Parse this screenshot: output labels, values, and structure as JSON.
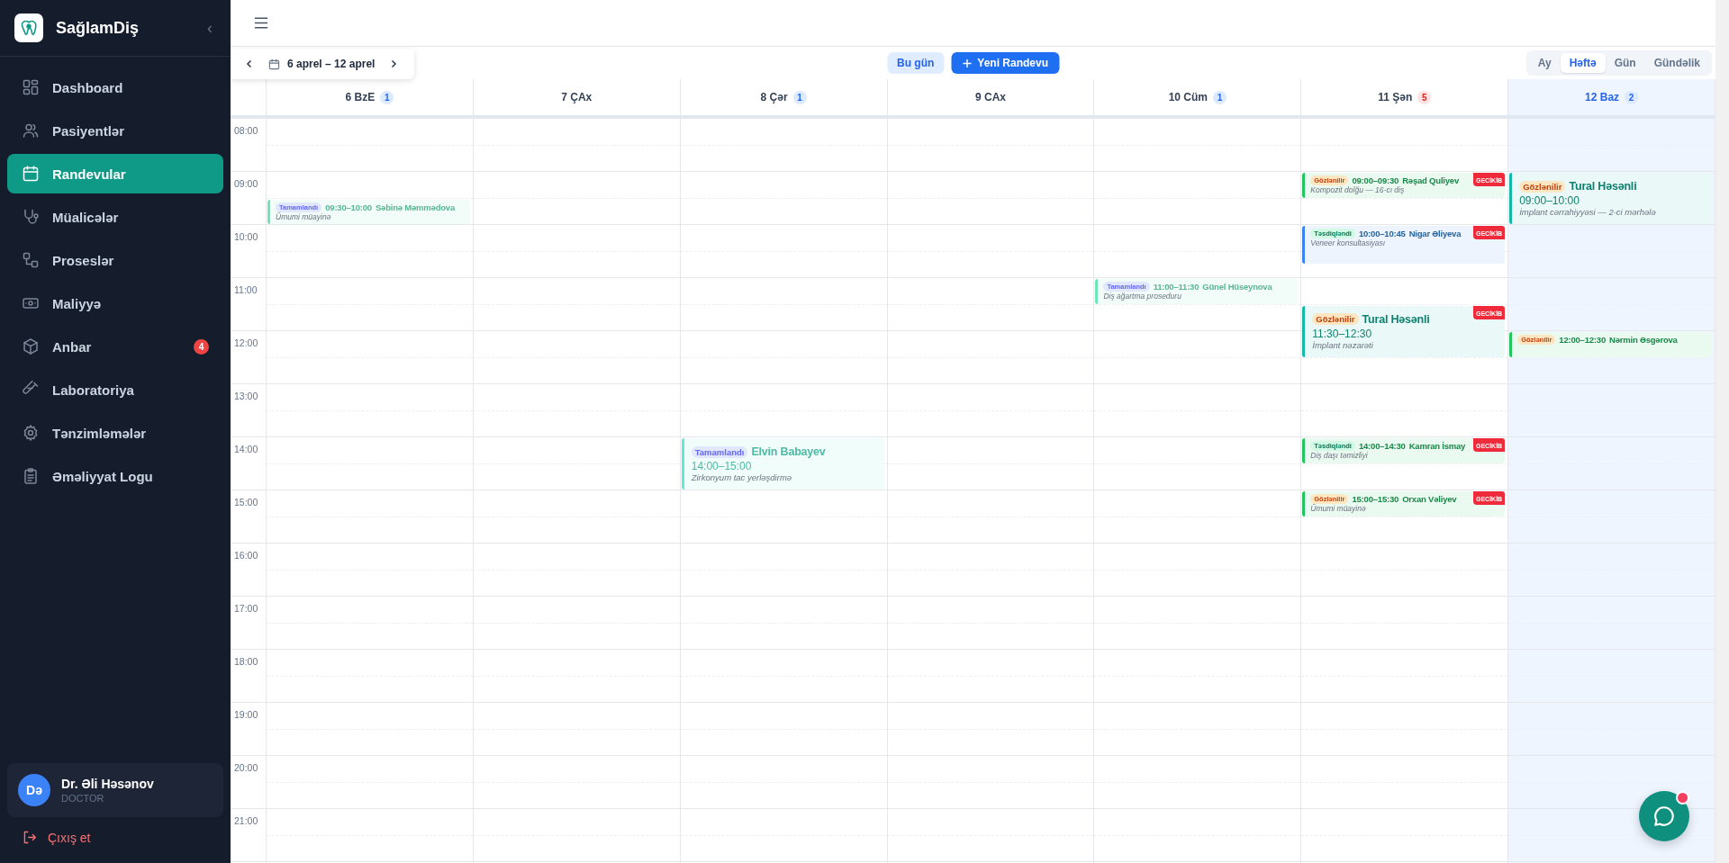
{
  "sidebar": {
    "brand": "SağlamDiş",
    "collapse": "‹",
    "items": [
      {
        "label": "Dashboard",
        "selected": false
      },
      {
        "label": "Pasiyentlər",
        "selected": false
      },
      {
        "label": "Randevular",
        "selected": true
      },
      {
        "label": "Müalicələr",
        "selected": false
      },
      {
        "label": "Proseslər",
        "selected": false
      },
      {
        "label": "Maliyyə",
        "selected": false
      },
      {
        "label": "Anbar",
        "selected": false,
        "badge": "4"
      },
      {
        "label": "Laboratoriya",
        "selected": false
      },
      {
        "label": "Tənzimləmələr",
        "selected": false
      },
      {
        "label": "Əməliyyat Logu",
        "selected": false
      }
    ],
    "user": {
      "initials": "Də",
      "name": "Dr. Əli Həsənov",
      "role": "DOCTOR"
    },
    "logout": "Çıxış et"
  },
  "toolbar": {
    "range": "6 aprel – 12 aprel",
    "today": "Bu gün",
    "new": "Yeni Randevu",
    "views": [
      {
        "label": "Ay",
        "selected": false
      },
      {
        "label": "Həftə",
        "selected": true
      },
      {
        "label": "Gün",
        "selected": false
      },
      {
        "label": "Gündəlik",
        "selected": false
      }
    ]
  },
  "hours": [
    "08:00",
    "09:00",
    "10:00",
    "11:00",
    "12:00",
    "13:00",
    "14:00",
    "15:00",
    "16:00",
    "17:00",
    "18:00",
    "19:00",
    "20:00",
    "21:00"
  ],
  "days": [
    {
      "label": "6 BzE",
      "badge": {
        "count": "1",
        "alert": false
      },
      "today": false,
      "events": [
        {
          "kind": "compact",
          "status": {
            "kind": "completed",
            "label": "Tamamlandı"
          },
          "time": "09:30–10:00",
          "patient": "Səbinə Məmmədova",
          "note": "Ümumi müayinə",
          "color": "#6ee7b7"
        }
      ]
    },
    {
      "label": "7 ÇAx",
      "today": false
    },
    {
      "label": "8 Çər",
      "badge": {
        "count": "1",
        "alert": false
      },
      "today": false,
      "events": [
        {
          "kind": "stacked",
          "status": {
            "kind": "completed",
            "label": "Tamamlandı"
          },
          "time": "14:00–15:00",
          "patient": "Elvin Babayev",
          "note": "Zirkonyum tac yerləşdirmə",
          "color": "#5eead4"
        }
      ]
    },
    {
      "label": "9 CAx",
      "today": false
    },
    {
      "label": "10 Cüm",
      "badge": {
        "count": "1",
        "alert": false
      },
      "today": false,
      "events": [
        {
          "kind": "compact",
          "status": {
            "kind": "completed",
            "label": "Tamamlandı"
          },
          "time": "11:00–11:30",
          "patient": "Günel Hüseynova",
          "note": "Diş ağartma proseduru",
          "color": "#6ee7b7"
        }
      ]
    },
    {
      "label": "11 Şən",
      "badge": {
        "count": "5",
        "alert": true
      },
      "today": false,
      "events": [
        {
          "kind": "compact",
          "status": {
            "kind": "pending",
            "label": "Gözlənilir"
          },
          "time": "09:00–09:30",
          "patient": "Rəşad Quliyev",
          "note": "Kompozit dolğu — 16-cı diş",
          "color": "#22c55e",
          "late": "GECİKİB"
        },
        {
          "kind": "compact",
          "status": {
            "kind": "confirmed",
            "label": "Təsdiqləndi"
          },
          "time": "10:00–10:45",
          "patient": "Nigar Əliyeva",
          "note": "Veneer konsultasiyası",
          "color": "#3b82f6",
          "late": "GECİKİB"
        },
        {
          "kind": "stacked",
          "status": {
            "kind": "pending",
            "label": "Gözlənilir"
          },
          "time": "11:30–12:30",
          "patient": "Tural Həsənli",
          "note": "İmplant nəzarəti",
          "color": "#14b8a6",
          "late": "GECİKİB"
        },
        {
          "kind": "compact",
          "status": {
            "kind": "confirmed",
            "label": "Təsdiqləndi"
          },
          "time": "14:00–14:30",
          "patient": "Kamran İsmay",
          "note": "Diş daşı təmizliyi",
          "color": "#22c55e",
          "late": "GECİKİB"
        },
        {
          "kind": "compact",
          "status": {
            "kind": "pending",
            "label": "Gözlənilir"
          },
          "time": "15:00–15:30",
          "patient": "Orxan Vəliyev",
          "note": "Ümumi müayinə",
          "color": "#22c55e",
          "late": "GECİKİB"
        }
      ]
    },
    {
      "label": "12 Baz",
      "badge": {
        "count": "2",
        "alert": false
      },
      "today": true,
      "events": [
        {
          "kind": "stacked",
          "status": {
            "kind": "pending",
            "label": "Gözlənilir"
          },
          "time": "09:00–10:00",
          "patient": "Tural Həsənli",
          "note": "İmplant cərrahiyyəsi — 2-ci mərhələ",
          "color": "#14b8a6"
        },
        {
          "kind": "compact",
          "status": {
            "kind": "pending",
            "label": "Gözlənilir"
          },
          "time": "12:00–12:30",
          "patient": "Nərmin Əsgərova",
          "color": "#22c55e"
        }
      ]
    }
  ]
}
